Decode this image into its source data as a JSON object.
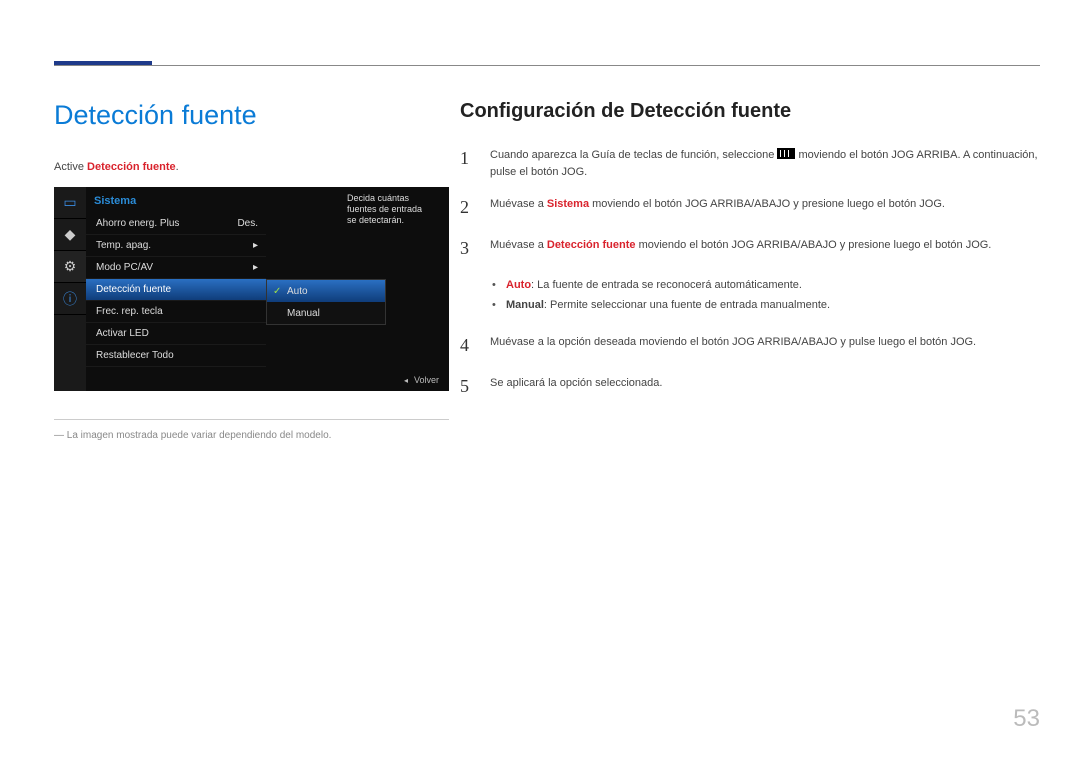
{
  "page_number": "53",
  "left": {
    "title": "Detección fuente",
    "intro_pre": "Active ",
    "intro_strong": "Detección fuente",
    "intro_post": ".",
    "disclaimer": "― La imagen mostrada puede variar dependiendo del modelo."
  },
  "osd": {
    "category": "Sistema",
    "tip_l1": "Decida cuántas",
    "tip_l2": "fuentes de entrada",
    "tip_l3": "se detectarán.",
    "items": [
      {
        "label": "Ahorro energ. Plus",
        "value": "Des."
      },
      {
        "label": "Temp. apag.",
        "value": "▸"
      },
      {
        "label": "Modo PC/AV",
        "value": "▸"
      },
      {
        "label": "Detección fuente",
        "value": ""
      },
      {
        "label": "Frec. rep. tecla",
        "value": ""
      },
      {
        "label": "Activar LED",
        "value": ""
      },
      {
        "label": "Restablecer Todo",
        "value": ""
      }
    ],
    "sub": [
      {
        "label": "Auto",
        "selected": true
      },
      {
        "label": "Manual",
        "selected": false
      }
    ],
    "footer": "Volver"
  },
  "right": {
    "title": "Configuración de Detección fuente",
    "steps": {
      "s1a": "Cuando aparezca la Guía de teclas de función, seleccione ",
      "s1b": " moviendo el botón JOG ARRIBA. A continuación, pulse el botón JOG.",
      "s2a": "Muévase a ",
      "s2s": "Sistema",
      "s2b": " moviendo el botón JOG ARRIBA/ABAJO y presione luego el botón JOG.",
      "s3a": "Muévase a ",
      "s3s": "Detección fuente",
      "s3b": " moviendo el botón JOG ARRIBA/ABAJO y presione luego el botón JOG.",
      "s4": "Muévase a la opción deseada moviendo el botón JOG ARRIBA/ABAJO y pulse luego el botón JOG.",
      "s5": "Se aplicará la opción seleccionada."
    },
    "bullets": {
      "auto_label": "Auto",
      "auto_text": ": La fuente de entrada se reconocerá automáticamente.",
      "manual_label": "Manual",
      "manual_text": ": Permite seleccionar una fuente de entrada manualmente."
    }
  }
}
